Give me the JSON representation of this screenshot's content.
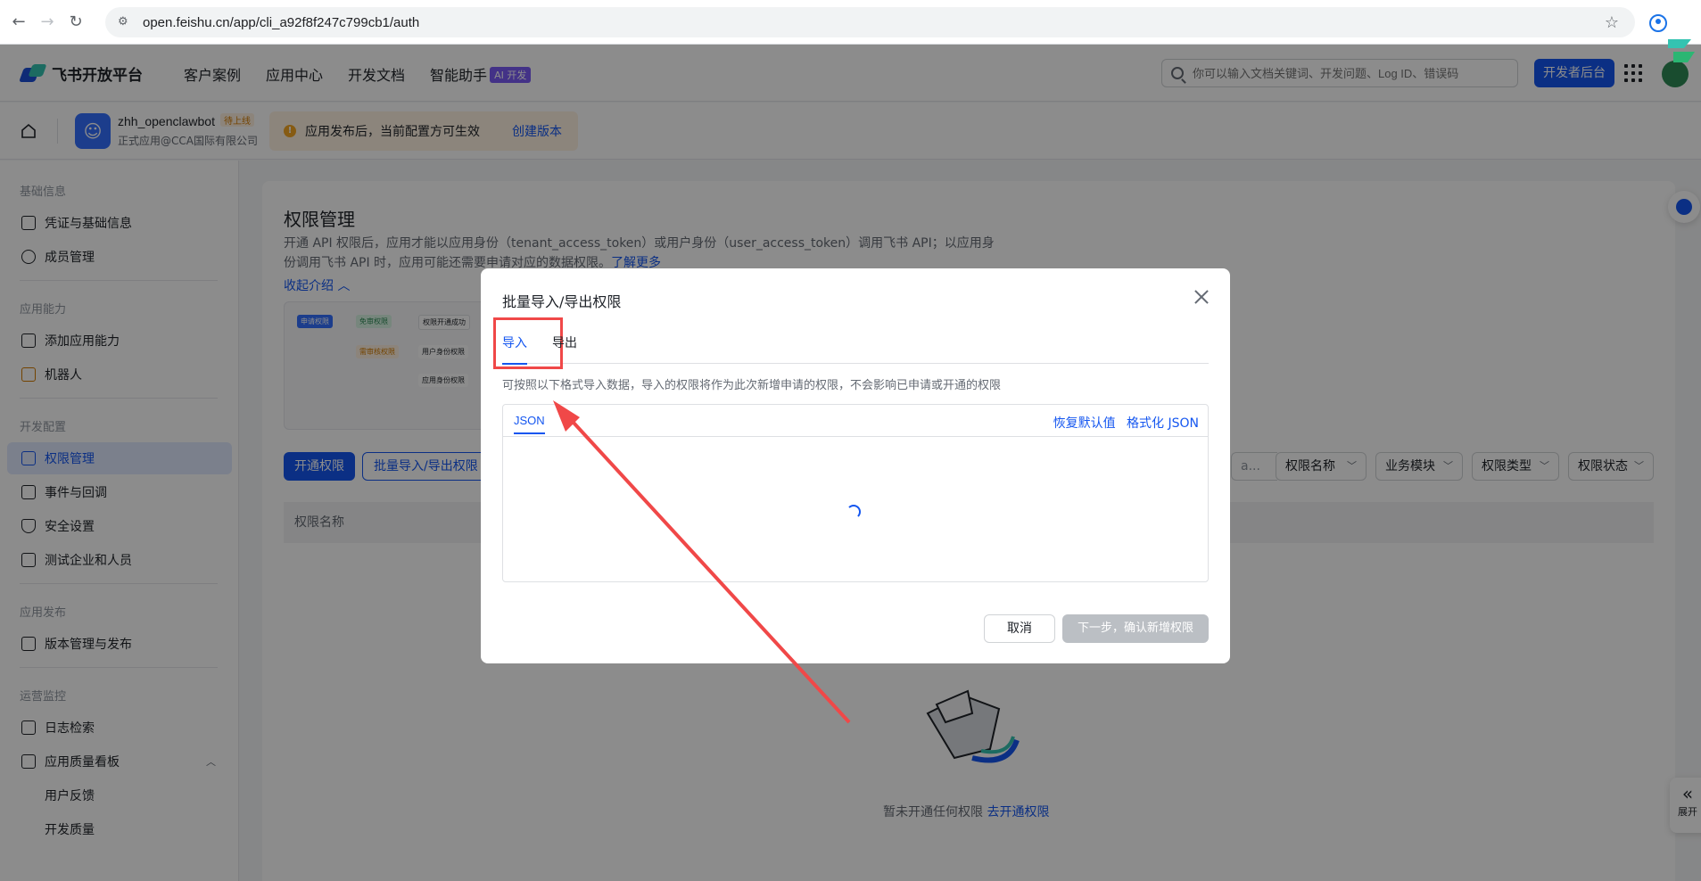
{
  "browser": {
    "url": "open.feishu.cn/app/cli_a92f8f247c799cb1/auth"
  },
  "header": {
    "logo_text": "飞书开放平台",
    "nav": [
      "客户案例",
      "应用中心",
      "开发文档",
      "智能助手"
    ],
    "ai_badge": "AI 开发",
    "search_placeholder": "你可以输入文档关键词、开发问题、Log ID、错误码",
    "dev_button": "开发者后台"
  },
  "app": {
    "name": "zhh_openclawbot",
    "status": "待上线",
    "sub": "正式应用@CCA国际有限公司",
    "notice_text": "应用发布后，当前配置方可生效",
    "notice_link": "创建版本"
  },
  "sidebar": {
    "groups": [
      "基础信息",
      "应用能力",
      "开发配置",
      "应用发布",
      "运营监控"
    ],
    "items": [
      {
        "label": "凭证与基础信息"
      },
      {
        "label": "成员管理"
      },
      {
        "label": "添加应用能力"
      },
      {
        "label": "机器人"
      },
      {
        "label": "权限管理"
      },
      {
        "label": "事件与回调"
      },
      {
        "label": "安全设置"
      },
      {
        "label": "测试企业和人员"
      },
      {
        "label": "版本管理与发布"
      },
      {
        "label": "日志检索"
      },
      {
        "label": "应用质量看板"
      },
      {
        "label": "用户反馈"
      },
      {
        "label": "开发质量"
      }
    ]
  },
  "main": {
    "title": "权限管理",
    "desc": "开通 API 权限后，应用才能以应用身份（tenant_access_token）或用户身份（user_access_token）调用飞书 API；以应用身份调用飞书 API 时，应用可能还需要申请对应的数据权限。",
    "desc_link": "了解更多",
    "collapse": "收起介绍",
    "flow": [
      "申请权限",
      "免审权限",
      "权限开通成功",
      "需审核权限",
      "用户身份权限",
      "应用身份权限"
    ],
    "open_button": "开通权限",
    "batch_button": "批量导入/导出权限",
    "filters": [
      "权限名称",
      "业务模块",
      "权限类型",
      "权限状态"
    ],
    "search_stub": "a...",
    "table_header": "权限名称",
    "empty_text": "暂未开通任何权限",
    "empty_link": "去开通权限"
  },
  "float": {
    "expand_label": "展开"
  },
  "modal": {
    "title": "批量导入/导出权限",
    "tabs": [
      "导入",
      "导出"
    ],
    "desc": "可按照以下格式导入数据，导入的权限将作为此次新增申请的权限，不会影响已申请或开通的权限",
    "editor_tab": "JSON",
    "restore": "恢复默认值",
    "format": "格式化 JSON",
    "cancel": "取消",
    "next": "下一步，确认新增权限"
  },
  "colors": {
    "primary": "#1456f0",
    "annotation": "#f04848"
  }
}
